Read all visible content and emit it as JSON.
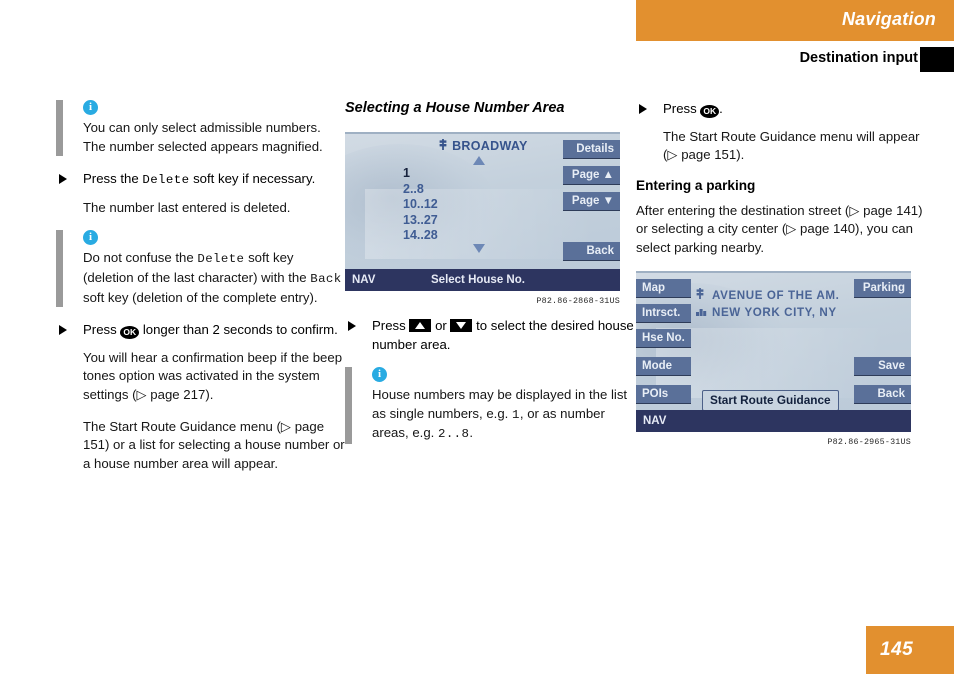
{
  "header": {
    "section": "Navigation",
    "subsection": "Destination input"
  },
  "footer": {
    "page_number": "145",
    "accent_color": "#e2902f"
  },
  "left_column": {
    "note1": {
      "icon": "info-icon",
      "text": "You can only select admissible numbers. The number selected appears magnified."
    },
    "step1": {
      "pre": "Press the",
      "key": "Delete",
      "post": "soft key if necessary."
    },
    "step1_result": "The number last entered is deleted.",
    "note2": {
      "icon": "info-icon",
      "part1": "Do not confuse the",
      "key1": "Delete",
      "part2": "soft key (deletion of the last character) with the",
      "key2": "Back",
      "part3": "soft key (deletion of the complete entry)."
    },
    "step2": {
      "pre": "Press",
      "key": "OK",
      "post": "longer than 2 seconds to confirm."
    },
    "step2_result1": "You will hear a confirmation beep if the beep tones option was activated in the system settings (▷ page 217).",
    "step2_result2": "The Start Route Guidance menu (▷ page 151) or a list for selecting a house number or a house number area will appear."
  },
  "middle_column": {
    "heading": "Selecting a House Number Area",
    "screen": {
      "street_icon": "street-sign-icon",
      "street": "BROADWAY",
      "numbers": [
        "1",
        "2..8",
        "10..12",
        "13..27",
        "14..28"
      ],
      "selected_index": 0,
      "scroll_up_icon": "scroll-up-arrow-icon",
      "scroll_down_icon": "scroll-down-arrow-icon",
      "softkeys_right": [
        "Details",
        "Page ▲",
        "Page ▼",
        "Back"
      ],
      "status_label": "NAV",
      "status_title": "Select House No."
    },
    "caption": "P82.86-2868-31US",
    "step1": {
      "pre": "Press",
      "key_up": "up-arrow-key",
      "mid": "or",
      "key_down": "down-arrow-key",
      "post": "to select the desired house number area."
    },
    "note": {
      "icon": "info-icon",
      "part1": "House numbers may be displayed in the list as single numbers, e.g.",
      "mono1": "1",
      "part2": ", or as number areas, e.g.",
      "mono2": "2..8",
      "part3": "."
    }
  },
  "right_column": {
    "step1": {
      "pre": "Press",
      "key": "OK",
      "post": "."
    },
    "step1_result": "The Start Route Guidance menu will appear (▷ page 151).",
    "heading": "Entering a parking",
    "body": "After entering the destination street (▷ page 141) or selecting a city center (▷ page 140), you can select parking nearby.",
    "screen": {
      "softkeys_left": [
        "Map",
        "Intrsct.",
        "Hse No.",
        "Mode",
        "POIs"
      ],
      "softkeys_right": [
        "Parking",
        "Save",
        "Back"
      ],
      "street_icon": "street-sign-icon",
      "street": "AVENUE OF THE AM.",
      "city_icon": "city-buildings-icon",
      "city": "NEW YORK CITY, NY",
      "highlight_button": "Start Route Guidance",
      "status_label": "NAV"
    },
    "caption": "P82.86-2965-31US"
  }
}
